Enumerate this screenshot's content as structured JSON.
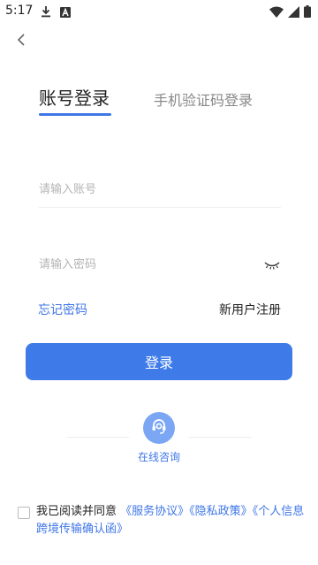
{
  "status_bar": {
    "time": "5:17",
    "left_icons": [
      "download-icon",
      "a-badge-icon"
    ],
    "right_icons": [
      "wifi-icon",
      "signal-icon",
      "battery-icon"
    ]
  },
  "nav": {
    "back_icon": "chevron-left-icon"
  },
  "tabs": [
    {
      "label": "账号登录",
      "active": true
    },
    {
      "label": "手机验证码登录",
      "active": false
    }
  ],
  "form": {
    "account_placeholder": "请输入账号",
    "account_value": "",
    "password_placeholder": "请输入密码",
    "password_value": "",
    "password_visibility_icon": "eye-closed-icon"
  },
  "links": {
    "forgot_password": "忘记密码",
    "register": "新用户注册"
  },
  "login_button": "登录",
  "consult": {
    "label": "在线咨询",
    "icon": "headset-icon"
  },
  "agreement": {
    "checked": false,
    "prefix": "我已阅读并同意",
    "service": "《服务协议》",
    "privacy": "《隐私政策》",
    "personal_info": "《个人信息跨境传输确认函》"
  },
  "colors": {
    "accent": "#3e7be9",
    "link": "#3f76e7",
    "icon_circle": "#7aa6f4"
  }
}
